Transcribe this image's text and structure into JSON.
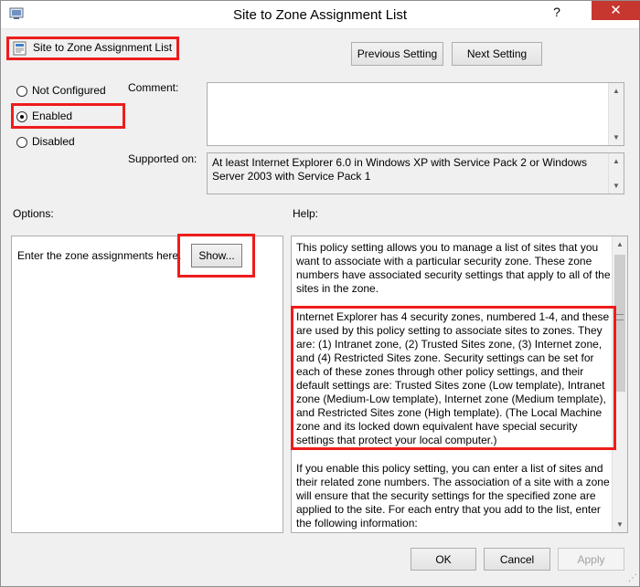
{
  "window": {
    "title": "Site to Zone Assignment List",
    "help_glyph": "?",
    "close_glyph": "✕"
  },
  "header": {
    "setting_name": "Site to Zone Assignment List",
    "previous_button": "Previous Setting",
    "next_button": "Next Setting"
  },
  "state": {
    "options": [
      {
        "label": "Not Configured",
        "selected": false
      },
      {
        "label": "Enabled",
        "selected": true
      },
      {
        "label": "Disabled",
        "selected": false
      }
    ]
  },
  "labels": {
    "comment": "Comment:",
    "supported_on": "Supported on:",
    "options": "Options:",
    "help": "Help:"
  },
  "comment": {
    "value": ""
  },
  "supported_on": {
    "value": "At least Internet Explorer 6.0 in Windows XP with Service Pack 2 or Windows Server 2003 with Service Pack 1"
  },
  "options_panel": {
    "instruction": "Enter the zone assignments here.",
    "show_button": "Show..."
  },
  "help": {
    "paragraphs": [
      "This policy setting allows you to manage a list of sites that you want to associate with a particular security zone. These zone numbers have associated security settings that apply to all of the sites in the zone.",
      "Internet Explorer has 4 security zones, numbered 1-4, and these are used by this policy setting to associate sites to zones. They are: (1) Intranet zone, (2) Trusted Sites zone, (3) Internet zone, and (4) Restricted Sites zone. Security settings can be set for each of these zones through other policy settings, and their default settings are: Trusted Sites zone (Low template), Intranet zone (Medium-Low template), Internet zone (Medium template), and Restricted Sites zone (High template). (The Local Machine zone and its locked down equivalent have special security settings that protect your local computer.)",
      "If you enable this policy setting, you can enter a list of sites and their related zone numbers. The association of a site with a zone will ensure that the security settings for the specified zone are applied to the site.  For each entry that you add to the list, enter the following information:"
    ]
  },
  "footer": {
    "ok": "OK",
    "cancel": "Cancel",
    "apply": "Apply"
  },
  "colors": {
    "highlight_red": "#ee1c1c",
    "close_red": "#c7372f",
    "window_bg": "#f0f0f0"
  }
}
